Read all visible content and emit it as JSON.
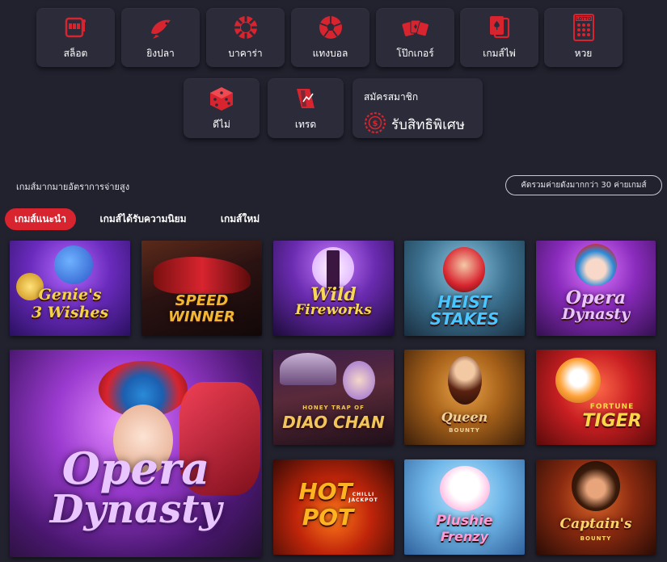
{
  "categories": [
    {
      "label": "สล็อต",
      "icon": "slot-machine-icon"
    },
    {
      "label": "ยิงปลา",
      "icon": "fish-icon"
    },
    {
      "label": "บาคาร่า",
      "icon": "poker-chip-icon"
    },
    {
      "label": "แทงบอล",
      "icon": "soccer-ball-icon"
    },
    {
      "label": "โป๊กเกอร์",
      "icon": "poker-cards-icon"
    },
    {
      "label": "เกมส์ไพ่",
      "icon": "playing-cards-icon"
    },
    {
      "label": "หวย",
      "icon": "lotto-ticket-icon",
      "icon_text": "LOTTO"
    },
    {
      "label": "ดีไม่",
      "icon": "dice-icon"
    },
    {
      "label": "เทรด",
      "icon": "trade-chart-icon"
    }
  ],
  "signup": {
    "small": "สมัครสมาชิก",
    "big": "รับสิทธิพิเศษ",
    "icon": "dollar-coin-icon"
  },
  "section": {
    "title": "เกมส์มากมายอัตราการจ่ายสูง",
    "button": "คัดรวมค่ายดังมากกว่า 30 ค่ายเกมส์"
  },
  "tabs": [
    {
      "label": "เกมส์แนะนำ",
      "active": true
    },
    {
      "label": "เกมส์ได้รับความนิยม",
      "active": false
    },
    {
      "label": "เกมส์ใหม่",
      "active": false
    }
  ],
  "games": [
    {
      "title": "Genie's 3 Wishes",
      "line1": "Genie's",
      "line2": "3 Wishes",
      "color": "#f3d24a"
    },
    {
      "title": "Speed Winner",
      "line1": "SPEED",
      "line2": "WINNER",
      "color": "#f2b731"
    },
    {
      "title": "Wild Fireworks",
      "line1": "Wild",
      "line2": "Fireworks",
      "color": "#f7d756"
    },
    {
      "title": "Heist Stakes",
      "line1": "HEIST",
      "line2": "STAKES",
      "color": "#49c6ff"
    },
    {
      "title": "Opera Dynasty",
      "line1": "Opera",
      "line2": "Dynasty",
      "color": "#e9c6ff"
    },
    {
      "title": "Opera Dynasty",
      "line1": "Opera",
      "line2": "Dynasty",
      "color": "#e9c6ff"
    },
    {
      "title": "Honey Trap of Diao Chan",
      "line1": "HONEY TRAP OF",
      "line2": "DIAO CHAN",
      "color": "#f2c55a"
    },
    {
      "title": "Queen of Bounty",
      "line1": "Queen",
      "line2": "BOUNTY",
      "color": "#f1d29a"
    },
    {
      "title": "Fortune Tiger",
      "line1": "FORTUNE",
      "line2": "TIGER",
      "color": "#ffd54a"
    },
    {
      "title": "Hot Pot",
      "line1": "HOT",
      "line2": "POT",
      "color": "#ffb320",
      "tag": "CHILLI JACKPOT"
    },
    {
      "title": "Plushie Frenzy",
      "line1": "Plushie",
      "line2": "Frenzy",
      "color": "#ff9bd6"
    },
    {
      "title": "Captain's Bounty",
      "line1": "Captain's",
      "line2": "BOUNTY",
      "color": "#ffd56a"
    }
  ],
  "colors": {
    "background": "#22222f",
    "card": "#2b2b39",
    "accent": "#d8242f"
  }
}
